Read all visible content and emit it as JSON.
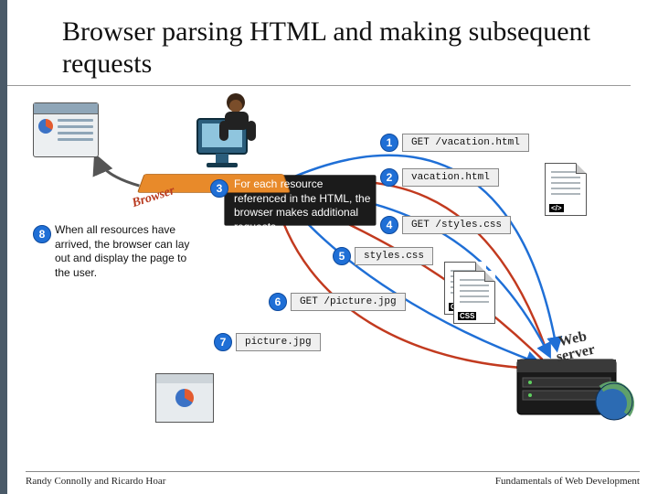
{
  "title": "Browser parsing HTML and making subsequent requests",
  "labels": {
    "browser": "Browser",
    "web_server_l1": "Web",
    "web_server_l2": "server"
  },
  "steps": {
    "s1": {
      "num": "1",
      "msg": "GET /vacation.html"
    },
    "s2": {
      "num": "2",
      "msg": "vacation.html"
    },
    "s3": {
      "num": "3",
      "text": "For each resource referenced in the HTML, the browser makes additional requests."
    },
    "s4": {
      "num": "4",
      "msg": "GET /styles.css"
    },
    "s5": {
      "num": "5",
      "msg": "styles.css"
    },
    "s6": {
      "num": "6",
      "msg": "GET /picture.jpg"
    },
    "s7": {
      "num": "7",
      "msg": "picture.jpg"
    },
    "s8": {
      "num": "8",
      "text": "When all resources have arrived, the browser can lay out and display the page to the user."
    }
  },
  "doc_tags": {
    "html": "</>",
    "css": "CSS"
  },
  "footer": {
    "left": "Randy Connolly and Ricardo Hoar",
    "right": "Fundamentals of Web Development"
  }
}
